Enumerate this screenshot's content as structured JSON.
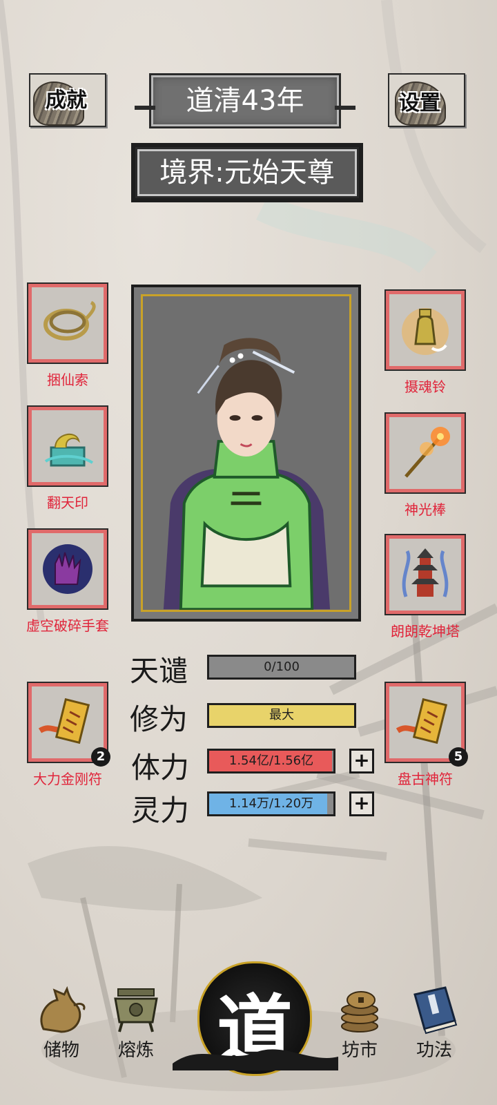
{
  "header": {
    "achievement_label": "成就",
    "settings_label": "设置",
    "year_title": "道清43年",
    "realm_title": "境界:元始天尊"
  },
  "left_items": [
    {
      "name": "捆仙索",
      "icon": "rope-icon",
      "count": null
    },
    {
      "name": "翻天印",
      "icon": "dragon-seal-icon",
      "count": null
    },
    {
      "name": "虚空破碎手套",
      "icon": "void-glove-icon",
      "count": null
    },
    {
      "name": "大力金刚符",
      "icon": "talisman-icon",
      "count": "2"
    }
  ],
  "right_items": [
    {
      "name": "摄魂铃",
      "icon": "bell-icon",
      "count": null
    },
    {
      "name": "神光棒",
      "icon": "fire-staff-icon",
      "count": null
    },
    {
      "name": "朗朗乾坤塔",
      "icon": "pagoda-icon",
      "count": null
    },
    {
      "name": "盘古神符",
      "icon": "talisman-icon",
      "count": "5"
    }
  ],
  "stats": {
    "tianqian": {
      "label": "天谴",
      "value": "0/100",
      "fill": 0.0,
      "color": "#8a8a8a"
    },
    "xiuwei": {
      "label": "修为",
      "value": "最大",
      "fill": 1.0,
      "color": "#e8d36a"
    },
    "tili": {
      "label": "体力",
      "value": "1.54亿/1.56亿",
      "fill": 0.987,
      "color": "#e85a5a"
    },
    "lingli": {
      "label": "灵力",
      "value": "1.14万/1.20万",
      "fill": 0.95,
      "color": "#6fb3e6"
    }
  },
  "nav": {
    "storage": "储物",
    "smelt": "熔炼",
    "center": "道",
    "market": "坊市",
    "skills": "功法"
  }
}
